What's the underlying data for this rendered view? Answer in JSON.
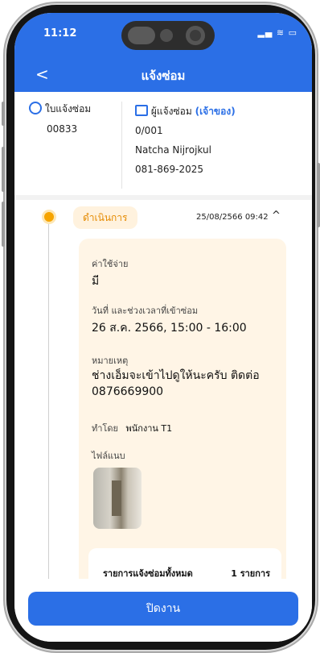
{
  "status_bar": {
    "time": "11:12",
    "icons": "signal wifi battery"
  },
  "header": {
    "title": "แจ้งซ่อม",
    "back_icon": "back-chevron-icon"
  },
  "request": {
    "label": "ใบแจ้งซ่อม",
    "number": "00833"
  },
  "reporter": {
    "label": "ผู้แจ้งซ่อม",
    "role": "(เจ้าของ)",
    "unit": "0/001",
    "name": "Natcha Nijrojkul",
    "phone": "081-869-2025"
  },
  "timeline": {
    "status": "ดำเนินการ",
    "datetime": "25/08/2566 09:42",
    "expanded": true,
    "details": {
      "cost_label": "ค่าใช้จ่าย",
      "cost_value": "มี",
      "schedule_label": "วันที่ และช่วงเวลาที่เข้าซ่อม",
      "schedule_value": "26 ส.ค. 2566, 15:00 - 16:00",
      "note_label": "หมายเหตุ",
      "note_value": "ช่างเอ็มจะเข้าไปดูให้นะครับ ติดต่อ 0876669900",
      "by_label": "ทำโดย",
      "by_value": "พนักงาน T1",
      "attachment_label": "ไฟล์แนบ"
    },
    "summary": {
      "label": "รายการแจ้งซ่อมทั้งหมด",
      "count": "1 รายการ"
    }
  },
  "footer": {
    "close_button": "ปิดงาน"
  },
  "colors": {
    "primary": "#2b6fe6",
    "status_orange": "#e58a00",
    "card_bg": "#fff5e6"
  }
}
